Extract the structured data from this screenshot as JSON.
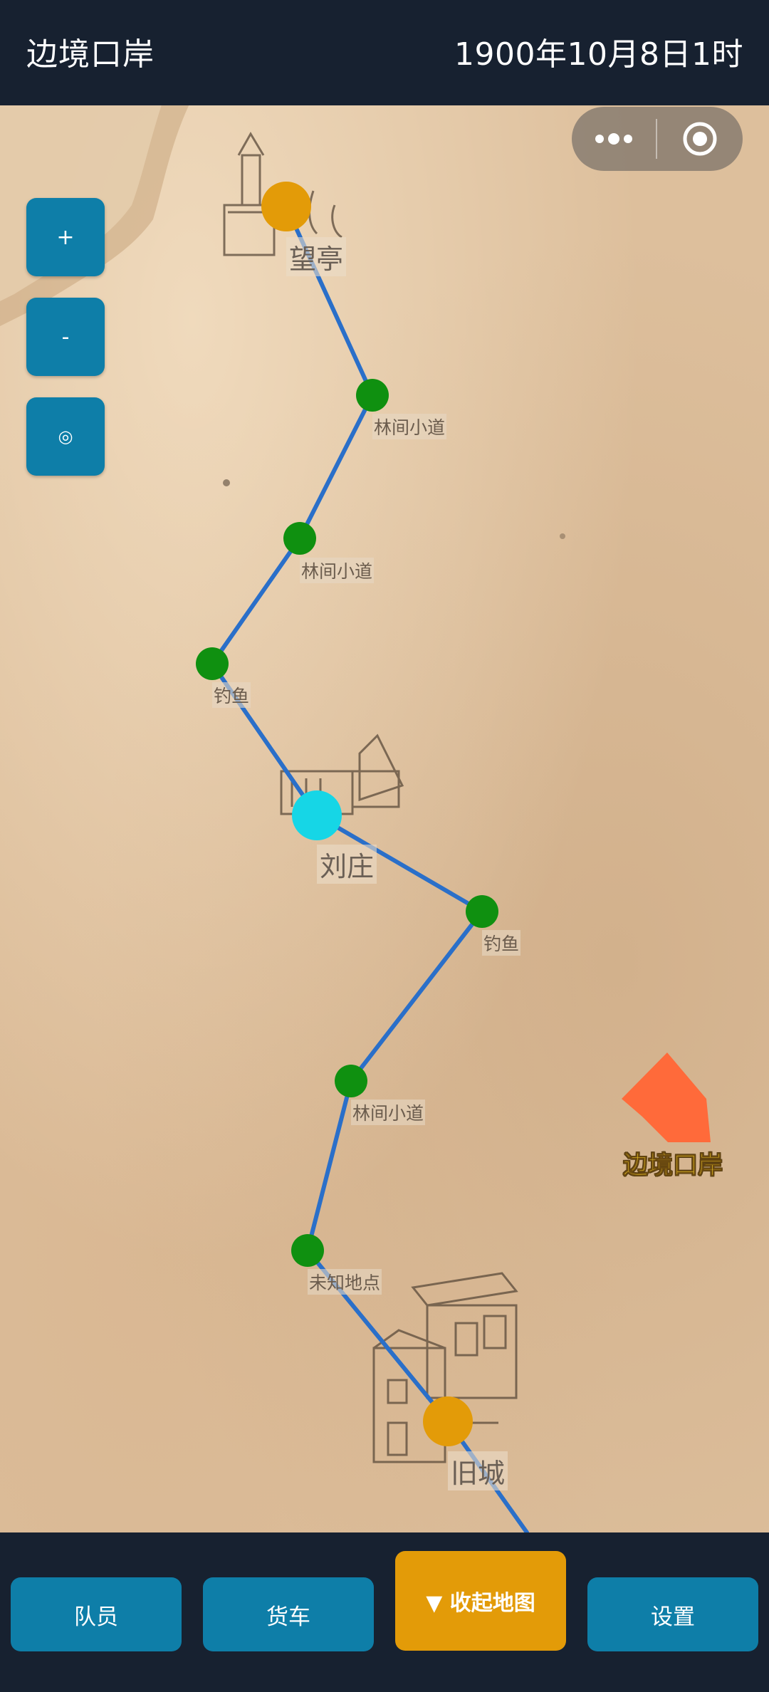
{
  "header": {
    "title": "边境口岸",
    "time": "1900年10月8日1时"
  },
  "zoom_controls": {
    "zoom_in": "+",
    "zoom_out": "-",
    "locate": "◎"
  },
  "capsule": {
    "more_icon": "more-dots-icon",
    "close_icon": "record-target-icon"
  },
  "map": {
    "route_color": "#2a6fc9",
    "node_colors": {
      "town": "#e39b08",
      "current": "#16d6e6",
      "waypoint": "#0f9010"
    },
    "places": [
      {
        "name": "望亭",
        "kind": "town"
      },
      {
        "name": "林间小道",
        "kind": "waypoint"
      },
      {
        "name": "林间小道",
        "kind": "waypoint"
      },
      {
        "name": "钓鱼",
        "kind": "waypoint"
      },
      {
        "name": "刘庄",
        "kind": "current"
      },
      {
        "name": "钓鱼",
        "kind": "waypoint"
      },
      {
        "name": "林间小道",
        "kind": "waypoint"
      },
      {
        "name": "未知地点",
        "kind": "waypoint"
      },
      {
        "name": "旧城",
        "kind": "town"
      }
    ],
    "destination": {
      "name": "边境口岸",
      "arrow_color": "#ff6a3a"
    }
  },
  "bottom_nav": {
    "members": "队员",
    "truck": "货车",
    "collapse_map": "▼ 收起地图",
    "settings": "设置"
  }
}
